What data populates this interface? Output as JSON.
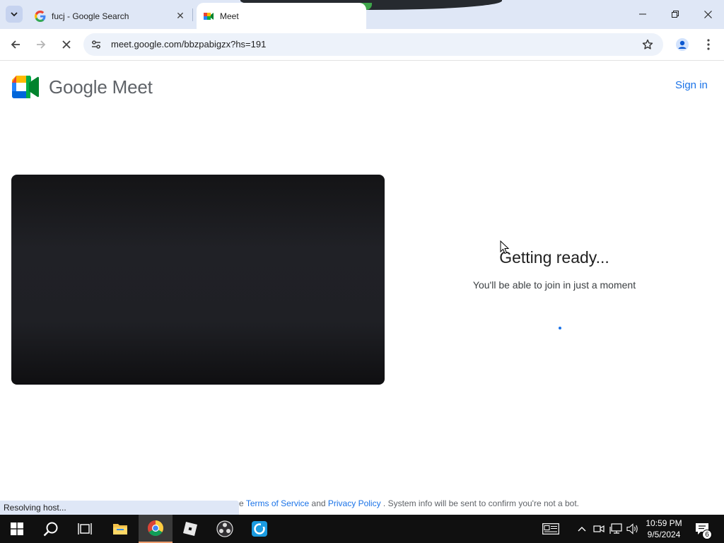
{
  "browser": {
    "tabs": [
      {
        "title": "fucj - Google Search",
        "active": false
      },
      {
        "title": "Meet",
        "active": true
      }
    ],
    "url": "meet.google.com/bbzpabigzx?hs=191",
    "status_bubble": "Resolving host..."
  },
  "page": {
    "logo_text": "Google Meet",
    "sign_in": "Sign in",
    "heading": "Getting ready...",
    "subheading": "You'll be able to join in just a moment",
    "footer": {
      "prefix": "e",
      "terms": "Terms of Service",
      "and": "and",
      "privacy": "Privacy Policy",
      "suffix": ". System info will be sent to confirm you're not a bot."
    }
  },
  "taskbar": {
    "apps": [
      "start-icon",
      "search-icon",
      "task-view-icon",
      "file-explorer-icon",
      "chrome-icon",
      "roblox-icon",
      "obs-icon",
      "app-icon"
    ],
    "time": "10:59 PM",
    "date": "9/5/2024",
    "notification_count": "6"
  },
  "colors": {
    "accent": "#1a73e8",
    "tabstrip": "#dfe7f6",
    "taskbar": "#101010"
  }
}
